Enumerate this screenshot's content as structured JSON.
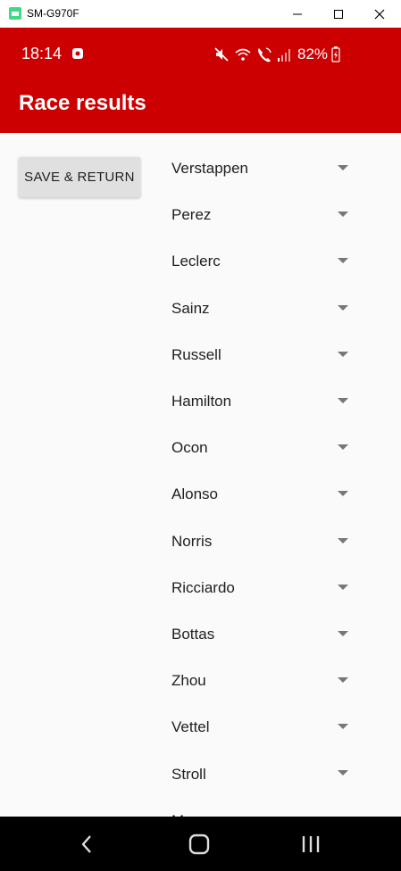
{
  "window": {
    "title": "SM-G970F"
  },
  "status_bar": {
    "time": "18:14",
    "battery": "82%"
  },
  "app_bar": {
    "title": "Race results"
  },
  "actions": {
    "save_label": "SAVE & RETURN"
  },
  "drivers": [
    {
      "name": "Verstappen"
    },
    {
      "name": "Perez"
    },
    {
      "name": "Leclerc"
    },
    {
      "name": "Sainz"
    },
    {
      "name": "Russell"
    },
    {
      "name": "Hamilton"
    },
    {
      "name": "Ocon"
    },
    {
      "name": "Alonso"
    },
    {
      "name": "Norris"
    },
    {
      "name": "Ricciardo"
    },
    {
      "name": "Bottas"
    },
    {
      "name": "Zhou"
    },
    {
      "name": "Vettel"
    },
    {
      "name": "Stroll"
    },
    {
      "name": "M"
    }
  ],
  "colors": {
    "accent": "#cc0000",
    "background": "#fafafa",
    "button": "#e0e0e0"
  }
}
